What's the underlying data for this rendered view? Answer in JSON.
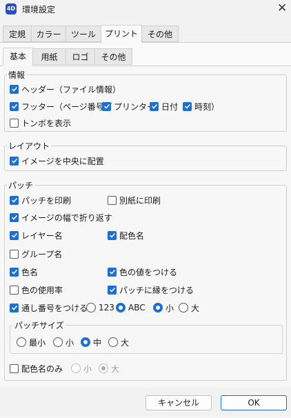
{
  "window": {
    "app_icon_text": "4D",
    "title": "環境設定"
  },
  "tabs": [
    "定規",
    "カラー",
    "ツール",
    "プリント",
    "その他"
  ],
  "subtabs": [
    "基本",
    "用紙",
    "ロゴ",
    "その他"
  ],
  "info": {
    "legend": "情報",
    "header": "ヘッダー（ファイル情報）",
    "footer": "フッター（ページ番号／",
    "printer": "プリンター",
    "date": "日付",
    "time": "時刻）",
    "trim": "トンボを表示"
  },
  "layout": {
    "legend": "レイアウト",
    "center": "イメージを中央に配置"
  },
  "patch": {
    "legend": "パッチ",
    "print_patch": "パッチを印刷",
    "separate": "別紙に印刷",
    "wrap": "イメージの幅で折り返す",
    "layer_name": "レイヤー名",
    "color_name": "配色名",
    "group_name": "グループ名",
    "color": "色名",
    "color_value": "色の値をつける",
    "usage": "色の使用率",
    "border": "パッチに縁をつける",
    "serial": "通し番号をつける",
    "serial_opts": [
      "123",
      "ABC"
    ],
    "serial_size": [
      "小",
      "大"
    ]
  },
  "patch_size": {
    "legend": "パッチサイズ",
    "options": [
      "最小",
      "小",
      "中",
      "大"
    ]
  },
  "name_only": {
    "label": "配色名のみ",
    "options": [
      "小",
      "大"
    ]
  },
  "buttons": {
    "cancel": "キャンセル",
    "ok": "OK"
  },
  "colors": {
    "accent": "#1f6fcf"
  }
}
